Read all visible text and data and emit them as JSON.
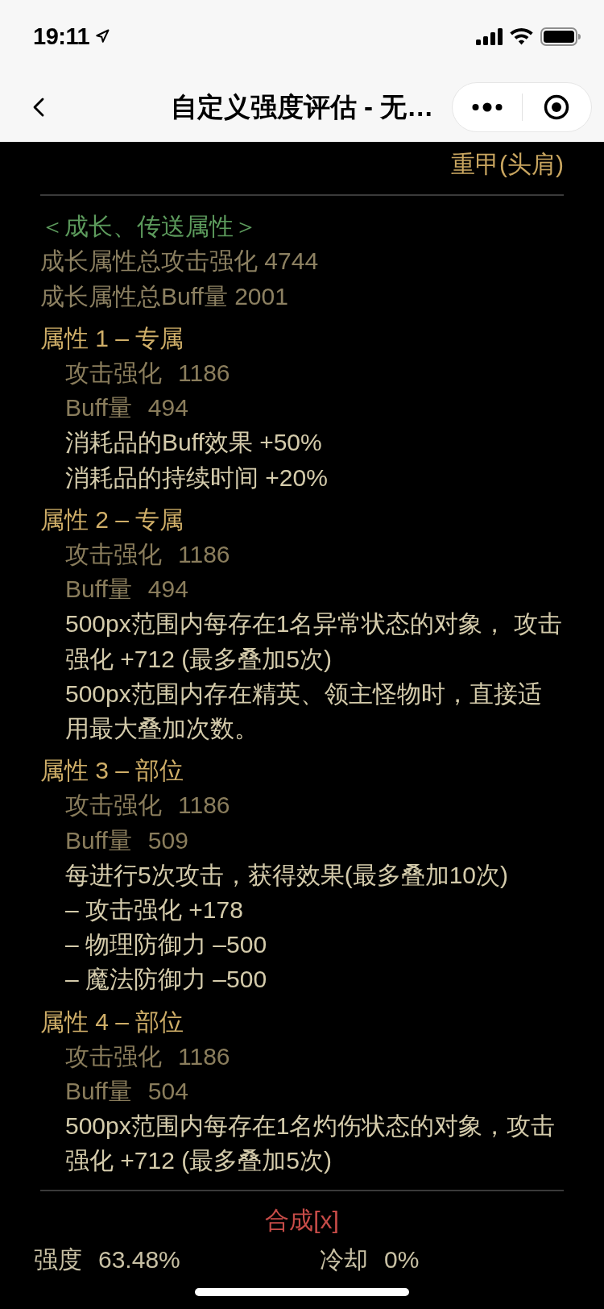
{
  "status_bar": {
    "time": "19:11"
  },
  "nav_bar": {
    "title": "自定义强度评估 - 无…"
  },
  "equipment_type": "重甲(头肩)",
  "growth_section": {
    "heading": "＜成长、传送属性＞",
    "lines": [
      "成长属性总攻击强化 4744",
      "成长属性总Buff量 2001"
    ]
  },
  "attributes": [
    {
      "title": "属性 1 – 专属",
      "lines": [
        {
          "kind": "stat",
          "label": "攻击强化",
          "value": "1186"
        },
        {
          "kind": "stat",
          "label": "Buff量",
          "value": "494"
        },
        {
          "kind": "effect",
          "text": "消耗品的Buff效果 +50%"
        },
        {
          "kind": "effect",
          "text": "消耗品的持续时间 +20%"
        }
      ]
    },
    {
      "title": "属性 2 – 专属",
      "lines": [
        {
          "kind": "stat",
          "label": "攻击强化",
          "value": "1186"
        },
        {
          "kind": "stat",
          "label": "Buff量",
          "value": "494"
        },
        {
          "kind": "effect",
          "text": "500px范围内每存在1名异常状态的对象， 攻击强化 +712 (最多叠加5次)"
        },
        {
          "kind": "effect",
          "text": "500px范围内存在精英、领主怪物时，直接适用最大叠加次数。"
        }
      ]
    },
    {
      "title": "属性 3 – 部位",
      "lines": [
        {
          "kind": "stat",
          "label": "攻击强化",
          "value": "1186"
        },
        {
          "kind": "stat",
          "label": "Buff量",
          "value": "509"
        },
        {
          "kind": "effect",
          "text": "每进行5次攻击，获得效果(最多叠加10次)"
        },
        {
          "kind": "effect",
          "text": "– 攻击强化 +178"
        },
        {
          "kind": "effect",
          "text": "– 物理防御力 –500"
        },
        {
          "kind": "effect",
          "text": "– 魔法防御力 –500"
        }
      ]
    },
    {
      "title": "属性 4 – 部位",
      "lines": [
        {
          "kind": "stat",
          "label": "攻击强化",
          "value": "1186"
        },
        {
          "kind": "stat",
          "label": "Buff量",
          "value": "504"
        },
        {
          "kind": "effect",
          "text": "500px范围内每存在1名灼伤状态的对象，攻击强化 +712 (最多叠加5次)"
        }
      ]
    }
  ],
  "synthesis_link": "合成[x]",
  "summary": [
    {
      "label": "强度",
      "value": "63.48%"
    },
    {
      "label": "冷却",
      "value": "0%"
    }
  ]
}
